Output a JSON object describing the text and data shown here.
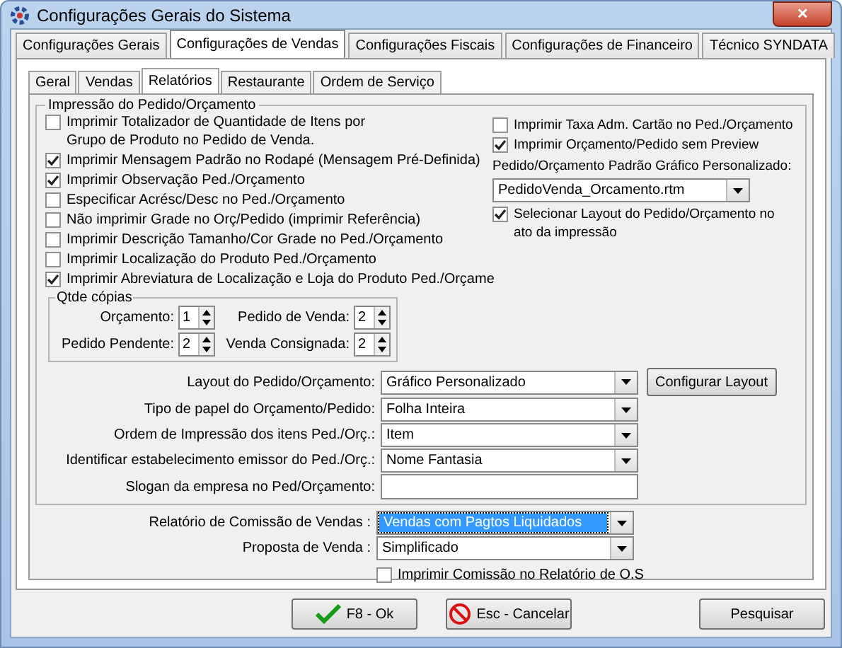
{
  "window": {
    "title": "Configurações Gerais do Sistema",
    "close": "✕"
  },
  "tabs": [
    {
      "label": "Configurações Gerais",
      "selected": false
    },
    {
      "label": "Configurações de Vendas",
      "selected": true
    },
    {
      "label": "Configurações Fiscais",
      "selected": false
    },
    {
      "label": "Configurações de Financeiro",
      "selected": false
    },
    {
      "label": "Técnico SYNDATA",
      "selected": false
    }
  ],
  "subtabs": [
    {
      "label": "Geral",
      "selected": false
    },
    {
      "label": "Vendas",
      "selected": false
    },
    {
      "label": "Relatórios",
      "selected": true
    },
    {
      "label": "Restaurante",
      "selected": false
    },
    {
      "label": "Ordem de Serviço",
      "selected": false
    }
  ],
  "group": {
    "title": "Impressão do Pedido/Orçamento",
    "left_options": [
      {
        "label": "Imprimir Totalizador de Quantidade de Itens por Grupo de Produto no Pedido de Venda.",
        "checked": false
      },
      {
        "label": "Imprimir Mensagem Padrão no Rodapé (Mensagem Pré-Definida)",
        "checked": true
      },
      {
        "label": "Imprimir Observação Ped./Orçamento",
        "checked": true
      },
      {
        "label": "Especificar Acrésc/Desc no Ped./Orçamento",
        "checked": false
      },
      {
        "label": "Não imprimir Grade no Orç/Pedido (imprimir Referência)",
        "checked": false
      },
      {
        "label": "Imprimir Descrição Tamanho/Cor Grade no Ped./Orçamento",
        "checked": false
      },
      {
        "label": "Imprimir Localização do Produto Ped./Orçamento",
        "checked": false
      },
      {
        "label": "Imprimir Abreviatura de Localização e Loja do Produto Ped./Orçame",
        "checked": true
      }
    ],
    "right_items": [
      {
        "kind": "checkbox",
        "label": "Imprimir Taxa Adm. Cartão no Ped./Orçamento",
        "checked": false
      },
      {
        "kind": "checkbox",
        "label": "Imprimir Orçamento/Pedido sem Preview",
        "checked": true
      },
      {
        "kind": "label",
        "label": "Pedido/Orçamento Padrão Gráfico Personalizado:"
      },
      {
        "kind": "dropdown",
        "value": "PedidoVenda_Orcamento.rtm"
      },
      {
        "kind": "checkbox",
        "label": "Selecionar Layout do Pedido/Orçamento no ato da impressão",
        "checked": true
      }
    ],
    "copies": {
      "title": "Qtde cópias",
      "fields": [
        {
          "label": "Orçamento:",
          "value": "1"
        },
        {
          "label": "Pedido de Venda:",
          "value": "2"
        },
        {
          "label": "Pedido Pendente:",
          "value": "2"
        },
        {
          "label": "Venda Consignada:",
          "value": "2"
        }
      ]
    },
    "rows": [
      {
        "kind": "dropdown",
        "label": "Layout do Pedido/Orçamento:",
        "value": "Gráfico Personalizado",
        "button": "Configurar Layout"
      },
      {
        "kind": "dropdown",
        "label": "Tipo de papel do Orçamento/Pedido:",
        "value": "Folha Inteira"
      },
      {
        "kind": "dropdown",
        "label": "Ordem de Impressão dos itens Ped./Orç.:",
        "value": "Item"
      },
      {
        "kind": "dropdown",
        "label": "Identificar estabelecimento emissor do Ped./Orç.:",
        "value": "Nome Fantasia"
      },
      {
        "kind": "text",
        "label": "Slogan da empresa no Ped/Orçamento:"
      }
    ]
  },
  "bottom_rows": [
    {
      "label": "Relatório de Comissão de Vendas :",
      "value": "Vendas com Pagtos Liquidados",
      "focused": true
    },
    {
      "label": "Proposta de Venda :",
      "value": "Simplificado",
      "focused": false
    }
  ],
  "bottom_check": {
    "label": "Imprimir Comissão no Relatório de O.S",
    "checked": false
  },
  "buttons": [
    {
      "kind": "ok",
      "label": "F8 - Ok"
    },
    {
      "kind": "cancel",
      "label": "Esc - Cancelar"
    },
    {
      "kind": "plain",
      "label": "Pesquisar"
    }
  ]
}
